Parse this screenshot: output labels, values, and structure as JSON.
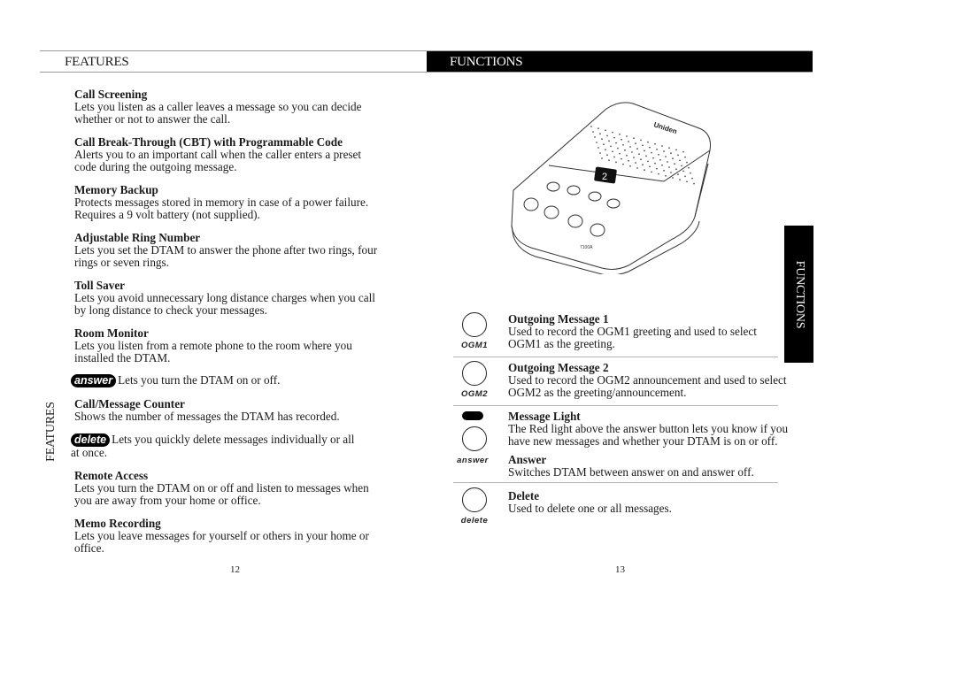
{
  "header": {
    "left_title": "FEATURES",
    "right_title": "FUNCTIONS"
  },
  "side_tabs": {
    "left": "FEATURES",
    "right": "FUNCTIONS"
  },
  "features": [
    {
      "title": "Call Screening",
      "description": "Lets you listen as a caller leaves a message so you can decide whether or not to answer the call."
    },
    {
      "title": "Call Break-Through (CBT) with Programmable Code",
      "description": "Alerts you to an important call when the caller enters a preset code during the outgoing message."
    },
    {
      "title": "Memory Backup",
      "description": "Protects messages stored in memory in case of a power failure. Requires a 9 volt battery (not supplied)."
    },
    {
      "title": "Adjustable Ring Number",
      "description": "Lets you set the DTAM to answer the phone after two rings, four rings or seven rings."
    },
    {
      "title": "Toll Saver",
      "description": "Lets you avoid unnecessary long distance charges when you call by long distance to check your messages."
    },
    {
      "title": "Room Monitor",
      "description": "Lets you listen from a remote phone to the room where you installed the DTAM."
    },
    {
      "title": "Call/Message Counter",
      "description": "Shows the number of messages the DTAM has recorded."
    },
    {
      "title": "Remote Access",
      "description": "Lets you turn the DTAM on or off and listen to messages when you are away from your home or office."
    },
    {
      "title": "Memo Recording",
      "description": "Lets you leave messages for yourself or others in your home or office."
    }
  ],
  "inline_buttons": {
    "answer": {
      "label": "answer",
      "description": "Lets you turn the DTAM on or off."
    },
    "delete": {
      "label": "delete",
      "description": "Lets you quickly delete messages individually or all at once."
    }
  },
  "functions": [
    {
      "button_label": "OGM1",
      "title": "Outgoing Message 1",
      "description": "Used to record the OGM1 greeting and used to select OGM1 as the greeting."
    },
    {
      "button_label": "OGM2",
      "title": "Outgoing Message 2",
      "description": "Used to record the OGM2 announcement and used to select OGM2 as the greeting/announcement."
    },
    {
      "button_label": "",
      "title": "Message Light",
      "description": "The Red light above the answer button lets you know if you have new messages and whether your DTAM is on or off."
    },
    {
      "button_label": "answer",
      "title": "Answer",
      "description": "Switches DTAM between answer on and answer off."
    },
    {
      "button_label": "delete",
      "title": "Delete",
      "description": "Used to delete one or all messages."
    }
  ],
  "device": {
    "brand": "Uniden",
    "display_digit": "2",
    "model": "7100A"
  },
  "page_numbers": {
    "left": "12",
    "right": "13"
  }
}
